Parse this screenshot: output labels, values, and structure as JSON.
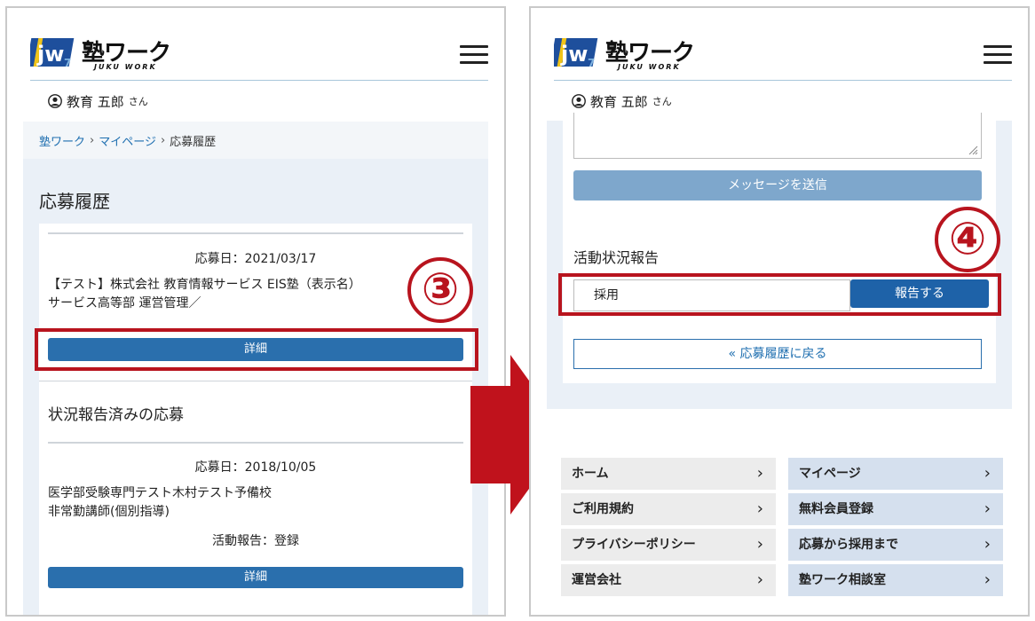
{
  "brand": {
    "name_jp": "塾ワーク",
    "name_en": "JUKU WORK"
  },
  "user": {
    "name": "教育 五郎",
    "suffix": "さん"
  },
  "breadcrumb": {
    "home": "塾ワーク",
    "mypage": "マイページ",
    "current": "応募履歴",
    "sep": "›"
  },
  "page": {
    "title": "応募履歴"
  },
  "application1": {
    "date": "応募日：2021/03/17",
    "line1": "【テスト】株式会社 教育情報サービス EIS塾（表示名）",
    "line2": "サービス高等部 運営管理／",
    "detail_label": "詳細"
  },
  "reported_section": {
    "title": "状況報告済みの応募"
  },
  "application2": {
    "date": "応募日：2018/10/05",
    "line1": "医学部受験専門テスト木村テスト予備校",
    "line2": "非常勤講師(個別指導)",
    "status": "活動報告：登録",
    "detail_label": "詳細"
  },
  "annotations": {
    "step3": "③",
    "step4": "④"
  },
  "message": {
    "send_label": "メッセージを送信"
  },
  "activity": {
    "title": "活動状況報告",
    "selected": "採用",
    "report_label": "報告する",
    "back_label": "« 応募履歴に戻る"
  },
  "footer_links": [
    {
      "label": "ホーム"
    },
    {
      "label": "マイページ"
    },
    {
      "label": "ご利用規約"
    },
    {
      "label": "無料会員登録"
    },
    {
      "label": "プライバシーポリシー"
    },
    {
      "label": "応募から採用まで"
    },
    {
      "label": "運営会社"
    },
    {
      "label": "塾ワーク相談室"
    }
  ],
  "colors": {
    "accent": "#2a6fad",
    "annotation_red": "#b8141e",
    "content_bg": "#eaf0f7"
  }
}
